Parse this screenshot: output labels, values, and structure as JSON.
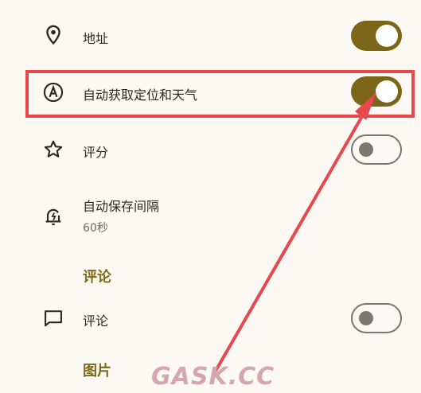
{
  "settings": {
    "address": {
      "label": "地址",
      "toggle_on": true,
      "icon": "location-pin-icon"
    },
    "auto_location": {
      "label": "自动获取定位和天气",
      "toggle_on": true,
      "icon": "auto-a-circle-icon"
    },
    "rating": {
      "label": "评分",
      "toggle_on": false,
      "icon": "star-icon"
    },
    "autosave": {
      "label": "自动保存间隔",
      "value": "60秒",
      "icon": "bell-alert-icon"
    }
  },
  "sections": {
    "comments_title": "评论",
    "images_title": "图片"
  },
  "comments": {
    "label": "评论",
    "toggle_on": false,
    "icon": "comment-icon"
  },
  "watermark": {
    "text": "GASK.CC"
  },
  "colors": {
    "accent": "#7a6519",
    "highlight": "#e8484d",
    "background": "#fcf8f4"
  }
}
